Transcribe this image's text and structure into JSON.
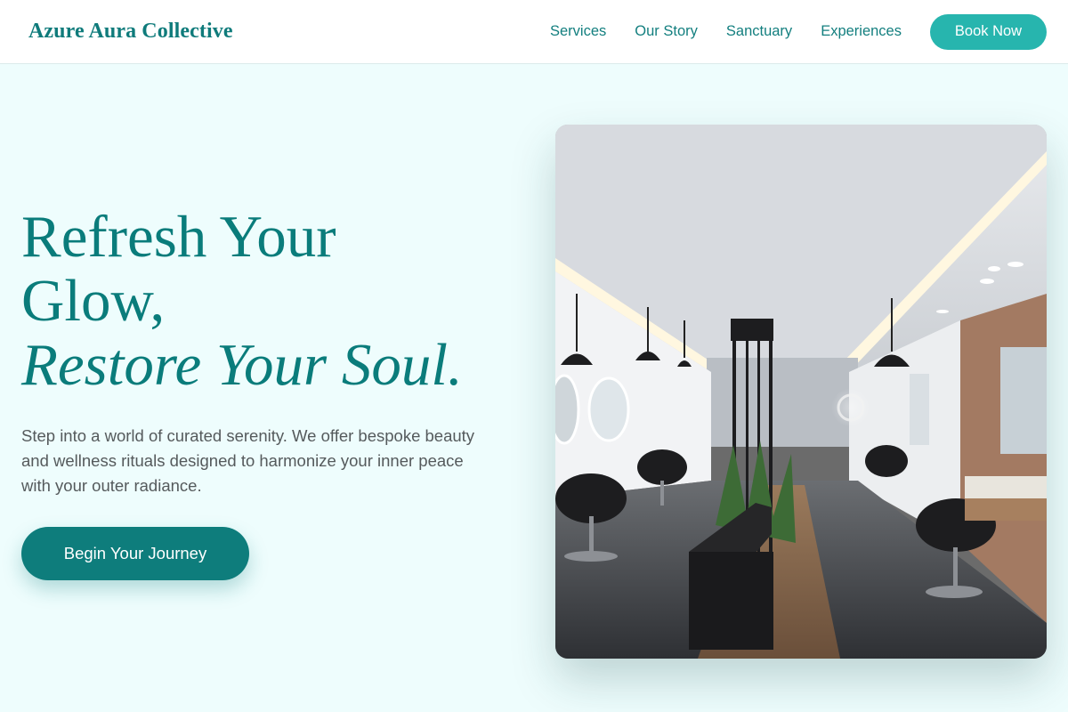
{
  "brand": {
    "name": "Azure Aura Collective"
  },
  "nav": {
    "links": [
      "Services",
      "Our Story",
      "Sanctuary",
      "Experiences"
    ],
    "cta_label": "Book Now"
  },
  "hero": {
    "headline_line1": "Refresh Your Glow,",
    "headline_line2": "Restore Your Soul.",
    "description": "Step into a world of curated serenity. We offer bespoke beauty and wellness rituals designed to harmonize your inner peace with your outer radiance.",
    "cta_label": "Begin Your Journey"
  },
  "colors": {
    "brand_teal": "#0f7b7b",
    "accent_teal": "#27b5ae",
    "background": "#eefdfd"
  },
  "icons": [
    "salon-interior-photo"
  ]
}
